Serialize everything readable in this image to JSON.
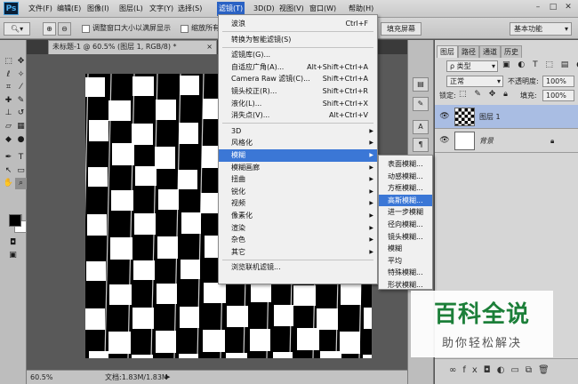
{
  "app": {
    "logo": "Ps"
  },
  "menubar": {
    "items": [
      "文件(F)",
      "编辑(E)",
      "图像(I)",
      "图层(L)",
      "文字(Y)",
      "选择(S)",
      "滤镜(T)",
      "3D(D)",
      "视图(V)",
      "窗口(W)",
      "帮助(H)"
    ],
    "active_index": 6,
    "window_buttons": [
      "–",
      "□",
      "✕"
    ]
  },
  "options_bar": {
    "checkbox1_label": "调整窗口大小以满屏显示",
    "checkbox2_label": "缩放所有",
    "fill_screen_button": "填充屏幕",
    "workspace_select": "基本功能"
  },
  "document": {
    "tab_title": "未标题-1 @ 60.5% (图层 1, RGB/8) *",
    "close_glyph": "×"
  },
  "status": {
    "zoom": "60.5%",
    "doc_size": "文档:1.83M/1.83M"
  },
  "filter_menu": {
    "items": [
      {
        "label": "波浪",
        "shortcut": "Ctrl+F"
      },
      {
        "label": "转换为智能滤镜(S)"
      },
      {
        "label": "滤镜库(G)..."
      },
      {
        "label": "自适应广角(A)...",
        "shortcut": "Alt+Shift+Ctrl+A"
      },
      {
        "label": "Camera Raw 滤镜(C)...",
        "shortcut": "Shift+Ctrl+A"
      },
      {
        "label": "镜头校正(R)...",
        "shortcut": "Shift+Ctrl+R"
      },
      {
        "label": "液化(L)...",
        "shortcut": "Shift+Ctrl+X"
      },
      {
        "label": "消失点(V)...",
        "shortcut": "Alt+Ctrl+V"
      },
      {
        "label": "3D",
        "submenu": true
      },
      {
        "label": "风格化",
        "submenu": true
      },
      {
        "label": "模糊",
        "submenu": true,
        "highlighted": true
      },
      {
        "label": "模糊画廊",
        "submenu": true
      },
      {
        "label": "扭曲",
        "submenu": true
      },
      {
        "label": "锐化",
        "submenu": true
      },
      {
        "label": "视频",
        "submenu": true
      },
      {
        "label": "像素化",
        "submenu": true
      },
      {
        "label": "渲染",
        "submenu": true
      },
      {
        "label": "杂色",
        "submenu": true
      },
      {
        "label": "其它",
        "submenu": true
      },
      {
        "label": "浏览联机滤镜..."
      }
    ]
  },
  "blur_submenu": {
    "items": [
      "表面模糊...",
      "动感模糊...",
      "方框模糊...",
      "高斯模糊...",
      "进一步模糊",
      "径向模糊...",
      "镜头模糊...",
      "模糊",
      "平均",
      "特殊模糊...",
      "形状模糊..."
    ],
    "highlighted_index": 3
  },
  "layers_panel": {
    "tabs": [
      "图层",
      "路径",
      "通道",
      "历史"
    ],
    "kind_select": "ρ 类型",
    "blend_mode": "正常",
    "opacity_label": "不透明度:",
    "opacity_value": "100%",
    "lock_label": "锁定:",
    "fill_label": "填充:",
    "fill_value": "100%",
    "layers": [
      {
        "name": "图层 1",
        "selected": true
      },
      {
        "name": "背景",
        "locked": true
      }
    ],
    "bottom_icons": [
      "link-icon",
      "fx-icon",
      "mask-icon",
      "adjustment-icon",
      "folder-icon",
      "new-layer-icon",
      "trash-icon"
    ]
  },
  "watermark": {
    "title": "百科全说",
    "subtitle": "助你轻松解决"
  },
  "colors": {
    "menu_highlight": "#3b77d6",
    "menubar_active": "#2a62c4",
    "layer_selected": "#a9bde3",
    "watermark_green": "#1c7f39"
  }
}
